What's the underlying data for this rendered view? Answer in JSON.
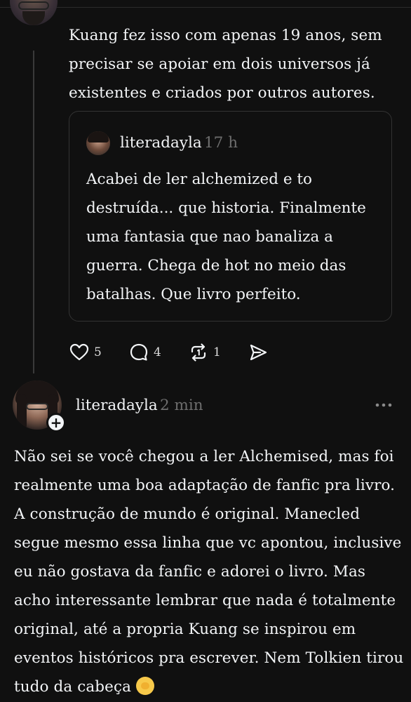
{
  "thread_post": {
    "text": "Kuang fez isso com apenas 19 anos, sem precisar se apoiar em dois universos já existentes e criados por outros autores."
  },
  "quoted_post": {
    "username": "literadayla",
    "time": "17 h",
    "text": "Acabei de ler alchemized e to destruída... que historia. Finalmente uma fantasia que nao banaliza a guerra. Chega de hot no meio das batalhas. Que livro perfeito."
  },
  "actions": {
    "likes": "5",
    "comments": "4",
    "reposts": "1"
  },
  "reply_post": {
    "username": "literadayla",
    "time": "2 min",
    "follow_symbol": "+",
    "text": "Não sei se você chegou a ler Alchemised, mas foi realmente uma boa adaptação de fanfic pra livro. A construção de mundo é original. Manecled segue mesmo essa linha que vc apontou, inclusive eu não gostava da fanfic e adorei o livro. Mas acho interessante lembrar que nada é totalmente original, até a propria Kuang se inspirou em eventos históricos pra escrever. Nem Tolkien tirou tudo da cabeça",
    "emoji": "face-with-hand-over-mouth"
  },
  "icons": {
    "like": "heart-icon",
    "comment": "comment-icon",
    "repost": "repost-icon",
    "share": "share-icon",
    "more": "more-icon"
  },
  "colors": {
    "background": "#101010",
    "text": "#f3f5f7",
    "muted": "#6e6e6e",
    "border": "#333333"
  }
}
